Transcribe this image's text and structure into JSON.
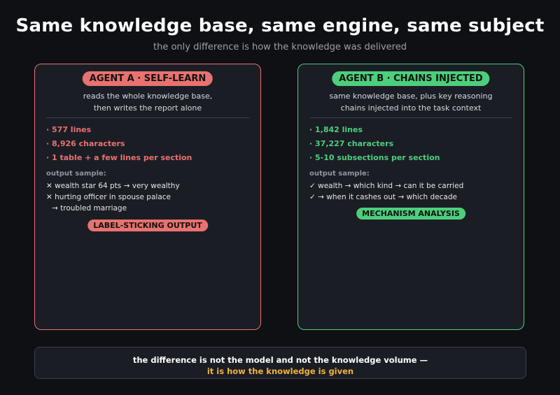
{
  "header": {
    "title": "Same knowledge base, same engine, same subject",
    "subtitle": "the only difference is how the knowledge was delivered"
  },
  "colors": {
    "agent_a": "#e8726f",
    "agent_b": "#4ccf7c",
    "highlight": "#f0b43a",
    "background": "#0f1013",
    "card": "#1b1d25"
  },
  "agent_a": {
    "label": "AGENT A · SELF-LEARN",
    "desc_line1": "reads the whole knowledge base,",
    "desc_line2": "then writes the report alone",
    "stats": [
      "· 577 lines",
      "· 8,926 characters",
      "· 1 table + a few lines per section"
    ],
    "sample_label": "output sample:",
    "sample_lines": [
      "✕ wealth star 64 pts → very wealthy",
      "✕ hurting officer in spouse palace",
      "→ troubled marriage"
    ],
    "verdict": "LABEL-STICKING OUTPUT"
  },
  "agent_b": {
    "label": "AGENT B · CHAINS INJECTED",
    "desc_line1": "same knowledge base, plus key reasoning",
    "desc_line2": "chains injected into the task context",
    "stats": [
      "· 1,842 lines",
      "· 37,227 characters",
      "· 5-10 subsections per section"
    ],
    "sample_label": "output sample:",
    "sample_lines": [
      "✓ wealth → which kind → can it be carried",
      "✓ → when it cashes out → which decade"
    ],
    "verdict": "MECHANISM ANALYSIS"
  },
  "conclusion": {
    "line1": "the difference is not the model and not the knowledge volume —",
    "line2": "it is how the knowledge is given"
  }
}
